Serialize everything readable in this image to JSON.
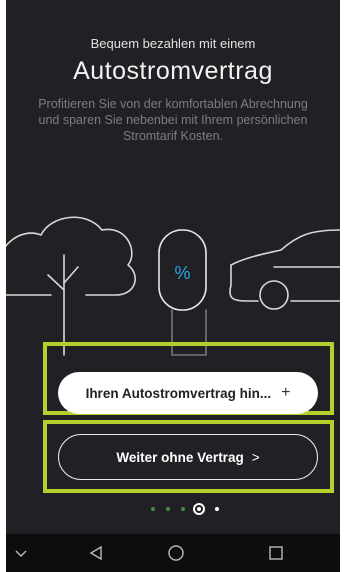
{
  "header": {
    "subtitle": "Bequem bezahlen mit einem",
    "title": "Autostromvertrag",
    "description": "Profitieren Sie von der komfortablen Abrechnung und sparen Sie nebenbei mit Ihrem persönlichen Stromtarif Kosten."
  },
  "illustration": {
    "badge_symbol": "%",
    "icons": [
      "tree-icon",
      "cloud-icon",
      "charging-station-icon",
      "car-icon"
    ]
  },
  "actions": {
    "add_contract_label": "Ihren Autostromvertrag hin...",
    "add_contract_icon": "+",
    "skip_label": "Weiter ohne Vertrag",
    "skip_icon": ">"
  },
  "pagination": {
    "total": 5,
    "current": 4
  },
  "navbar": {
    "items": [
      "collapse-icon",
      "back-icon",
      "home-icon",
      "recents-icon"
    ]
  },
  "colors": {
    "background": "#212125",
    "highlight": "#b7cf2c",
    "accent_blue": "#2aa7e0",
    "dot_green": "#3f8e3f"
  }
}
